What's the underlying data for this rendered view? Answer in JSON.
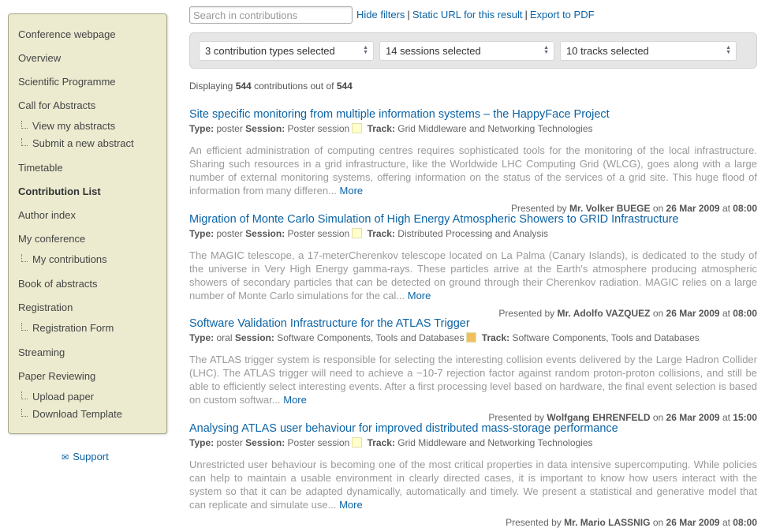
{
  "sidebar": {
    "items": [
      {
        "label": "Conference webpage"
      },
      {
        "label": "Overview"
      },
      {
        "label": "Scientific Programme"
      },
      {
        "label": "Call for Abstracts"
      },
      {
        "label": "View my abstracts"
      },
      {
        "label": "Submit a new abstract"
      },
      {
        "label": "Timetable"
      },
      {
        "label": "Contribution List"
      },
      {
        "label": "Author index"
      },
      {
        "label": "My conference"
      },
      {
        "label": "My contributions"
      },
      {
        "label": "Book of abstracts"
      },
      {
        "label": "Registration"
      },
      {
        "label": "Registration Form"
      },
      {
        "label": "Streaming"
      },
      {
        "label": "Paper Reviewing"
      },
      {
        "label": "Upload paper"
      },
      {
        "label": "Download Template"
      }
    ],
    "support": "Support"
  },
  "toolbar": {
    "search_placeholder": "Search in contributions",
    "hide_filters": "Hide filters",
    "static_url": "Static URL for this result",
    "export_pdf": "Export to PDF",
    "separator": "|"
  },
  "filters": {
    "types": "3 contribution types selected",
    "sessions": "14 sessions selected",
    "tracks": "10 tracks selected"
  },
  "summary": {
    "prefix": "Displaying",
    "shown": "544",
    "middle": "contributions out of",
    "total": "544"
  },
  "labels": {
    "type": "Type:",
    "session": "Session:",
    "track": "Track:",
    "presented_by": "Presented by",
    "on": "on",
    "at": "at",
    "more": "More"
  },
  "contributions": [
    {
      "title": "Site specific monitoring from multiple information systems – the HappyFace Project",
      "type": "poster",
      "session": "Poster session",
      "session_color": "#ffffcc",
      "track": "Grid Middleware and Networking Technologies",
      "description": "An efficient administration of computing centres requires sophisticated tools for the monitoring of the local infrastructure. Sharing such resources in a grid infrastructure, like the Worldwide LHC Computing Grid (WLCG), goes along with a large number of external monitoring systems, offering information on the status of the services of a grid site. This huge flood of information from many differen...",
      "presenter": "Mr. Volker BUEGE",
      "date": "26 Mar 2009",
      "time": "08:00"
    },
    {
      "title": "Migration of Monte Carlo Simulation of High Energy Atmospheric Showers to GRID Infrastructure",
      "type": "poster",
      "session": "Poster session",
      "session_color": "#ffffcc",
      "track": "Distributed Processing and Analysis",
      "description": "The MAGIC telescope, a 17-meterCherenkov telescope located on La Palma (Canary Islands), is dedicated to the study of the universe in Very High Energy gamma-rays. These particles arrive at the Earth's atmosphere producing atmospheric showers of secondary particles that can be detected on ground through their Cherenkov radiation. MAGIC relies on a large number of Monte Carlo simulations for the cal...",
      "presenter": "Mr. Adolfo VAZQUEZ",
      "date": "26 Mar 2009",
      "time": "08:00"
    },
    {
      "title": "Software Validation Infrastructure for the ATLAS Trigger",
      "type": "oral",
      "session": "Software Components, Tools and Databases",
      "session_color": "#f0c060",
      "track": "Software Components, Tools and Databases",
      "description": "The ATLAS trigger system is responsible for selecting the interesting collision events delivered by the Large Hadron Collider (LHC). The ATLAS trigger will need to achieve a ~10-7 rejection factor against random proton-proton collisions, and still be able to efficiently select interesting events. After a first processing level based on hardware, the final event selection is based on custom softwar...",
      "presenter": "Wolfgang EHRENFELD",
      "date": "26 Mar 2009",
      "time": "15:00"
    },
    {
      "title": "Analysing ATLAS user behaviour for improved distributed mass-storage performance",
      "type": "poster",
      "session": "Poster session",
      "session_color": "#ffffcc",
      "track": "Grid Middleware and Networking Technologies",
      "description": "Unrestricted user behaviour is becoming one of the most critical properties in data intensive supercomputing. While policies can help to maintain a usable environment in clearly directed cases, it is important to know how users interact with the system so that it can be adapted dynamically, automatically and timely. We present a statistical and generative model that can replicate and simulate use...",
      "presenter": "Mr. Mario LASSNIG",
      "date": "26 Mar 2009",
      "time": "08:00"
    }
  ]
}
